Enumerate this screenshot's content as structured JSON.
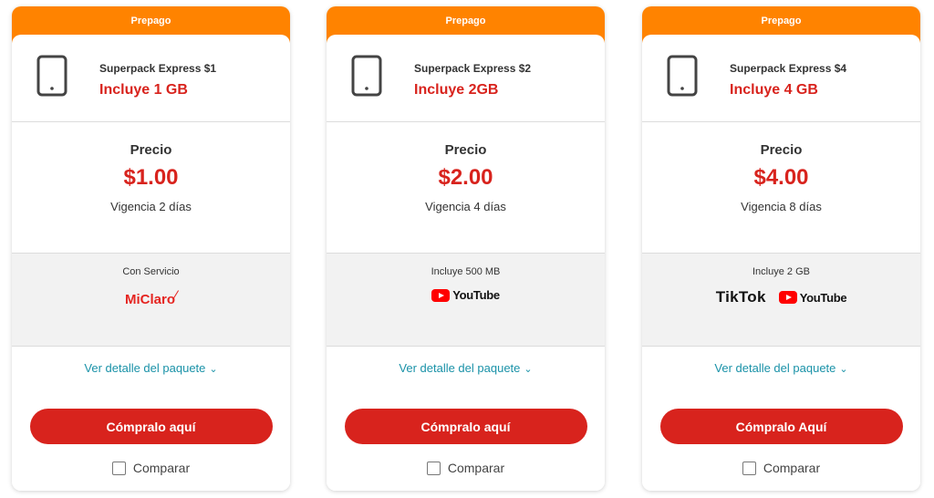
{
  "cards": [
    {
      "tab": "Prepago",
      "plan_name": "Superpack Express $1",
      "plan_gb": "Incluye 1 GB",
      "price_label": "Precio",
      "price": "$1.00",
      "validity": "Vigencia 2 días",
      "extra_label": "Con Servicio",
      "logos": [
        "miclaro"
      ],
      "detail_label": "Ver detalle del paquete",
      "buy_label": "Cómpralo aquí",
      "compare_label": "Comparar"
    },
    {
      "tab": "Prepago",
      "plan_name": "Superpack Express $2",
      "plan_gb": "Incluye 2GB",
      "price_label": "Precio",
      "price": "$2.00",
      "validity": "Vigencia 4 días",
      "extra_label": "Incluye 500 MB",
      "logos": [
        "youtube"
      ],
      "detail_label": "Ver detalle del paquete",
      "buy_label": "Cómpralo aquí",
      "compare_label": "Comparar"
    },
    {
      "tab": "Prepago",
      "plan_name": "Superpack Express $4",
      "plan_gb": "Incluye 4 GB",
      "price_label": "Precio",
      "price": "$4.00",
      "validity": "Vigencia 8 días",
      "extra_label": "Incluye 2 GB",
      "logos": [
        "tiktok",
        "youtube"
      ],
      "detail_label": "Ver detalle del paquete",
      "buy_label": "Cómpralo Aquí",
      "compare_label": "Comparar"
    }
  ],
  "logo_text": {
    "miclaro": "MiClaro",
    "youtube": "YouTube",
    "tiktok": "TikTok"
  },
  "colors": {
    "tab_orange": "#ff8300",
    "accent_red": "#d8231d",
    "link_teal": "#1a92a8",
    "panel_gray": "#f2f2f2"
  }
}
